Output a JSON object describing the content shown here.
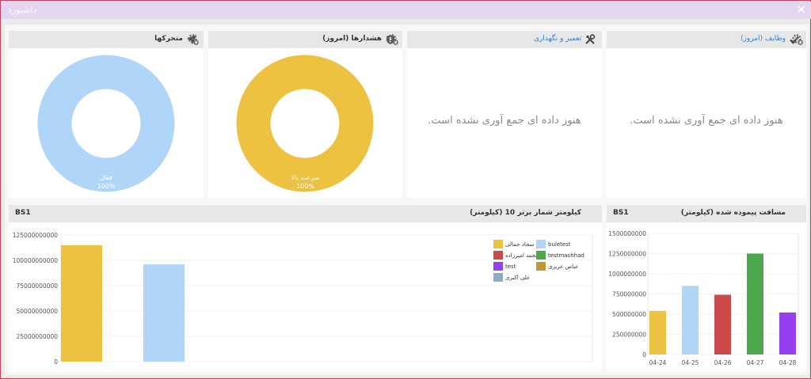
{
  "window": {
    "title": "داشبورد",
    "close_glyph": "✕"
  },
  "panels": {
    "movers": {
      "title": "متحرکها",
      "label": "فعال",
      "percent": "100%"
    },
    "alarms": {
      "title": "هشدارها (امروز)",
      "label": "سرعت بالا",
      "percent": "100%"
    },
    "maintenance": {
      "title": "تعمیر و نگهداری",
      "empty_text": "هنوز داده ای جمع آوری نشده است."
    },
    "tasks": {
      "title": "وظایف (امروز)",
      "empty_text": "هنوز داده ای جمع آوری نشده است."
    },
    "top10": {
      "title": "کیلومتر شمار برتر 10 (کیلومتر)",
      "tag": "BS1"
    },
    "distance": {
      "title": "مسافت پیموده شده (کیلومتر)",
      "tag": "BS1"
    }
  },
  "colors": {
    "donut_blue": "#afd6f8",
    "donut_yellow": "#edc240",
    "gear": "#6b6b6b"
  },
  "chart_data": [
    {
      "type": "pie",
      "labels": [
        "فعال"
      ],
      "values": [
        100
      ],
      "colors": [
        "#afd6f8"
      ]
    },
    {
      "type": "pie",
      "labels": [
        "سرعت بالا"
      ],
      "values": [
        100
      ],
      "colors": [
        "#edc240"
      ]
    },
    {
      "type": "bar",
      "title": "",
      "categories": [
        "سجاد جمالی",
        "buletest"
      ],
      "values": [
        115000000000,
        96000000000
      ],
      "colors": [
        "#edc240",
        "#afd6f8"
      ],
      "ylim": [
        0,
        125000000000
      ],
      "yticks": [
        "0",
        "25000000000",
        "50000000000",
        "75000000000",
        "100000000000",
        "125000000000"
      ],
      "grid": true,
      "legend": [
        {
          "name": "سجاد جمالی",
          "color": "#edc240"
        },
        {
          "name": "buletest",
          "color": "#afd6f8"
        },
        {
          "name": "محمد امیرزاده",
          "color": "#cb4b4b"
        },
        {
          "name": "testmashhad",
          "color": "#4da74d"
        },
        {
          "name": "test",
          "color": "#9440ed"
        },
        {
          "name": "عباس عزیزی",
          "color": "#bd9b33"
        },
        {
          "name": "علی اکبری",
          "color": "#8cacc6"
        }
      ],
      "legend_position": "top-right"
    },
    {
      "type": "bar",
      "title": "",
      "categories": [
        "04-24",
        "04-25",
        "04-26",
        "04-27",
        "04-28"
      ],
      "values": [
        540000000,
        850000000,
        740000000,
        1250000000,
        520000000
      ],
      "colors": [
        "#edc240",
        "#afd6f8",
        "#cb4b4b",
        "#4da74d",
        "#9440ed"
      ],
      "ylim": [
        0,
        1500000000
      ],
      "yticks": [
        "0",
        "250000000",
        "500000000",
        "750000000",
        "1000000000",
        "1250000000",
        "1500000000"
      ],
      "grid": true
    }
  ]
}
